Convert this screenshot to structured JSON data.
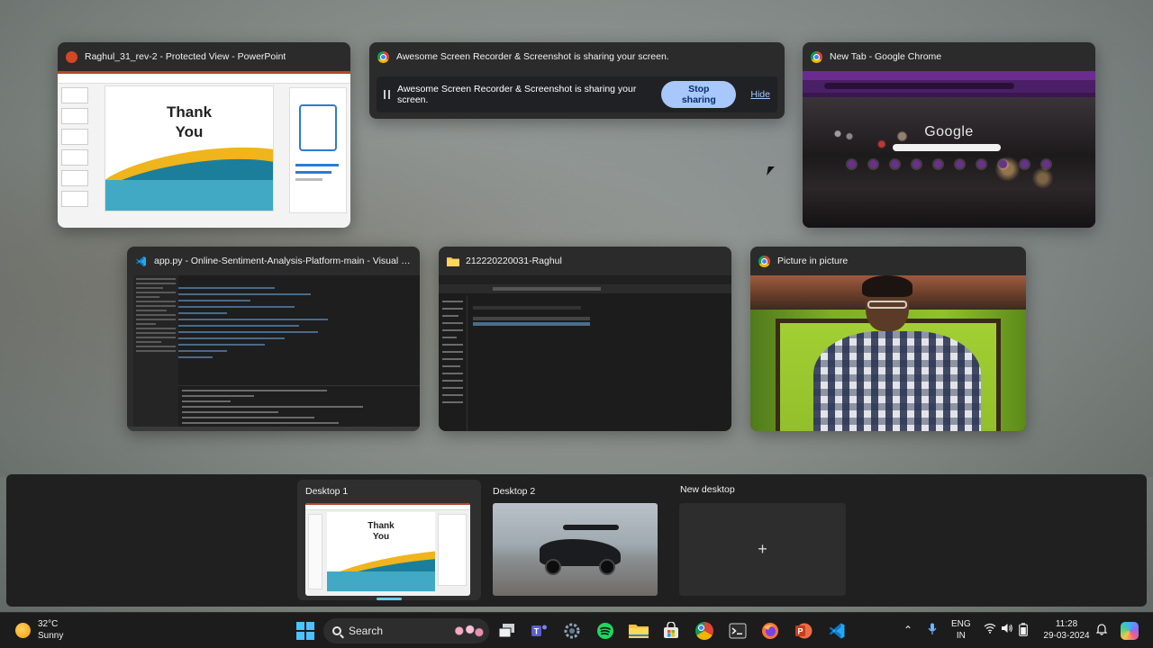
{
  "windows": [
    {
      "app": "powerpoint",
      "icon": "powerpoint-icon",
      "title": "Raghul_31_rev-2  -  Protected View - PowerPoint",
      "slide_text": "Thank You"
    },
    {
      "app": "chrome",
      "icon": "chrome-icon",
      "title": "New Tab - Google Chrome",
      "logo_text": "Google"
    },
    {
      "app": "vscode",
      "icon": "vscode-icon",
      "title": "app.py - Online-Sentiment-Analysis-Platform-main - Visual St..."
    },
    {
      "app": "explorer",
      "icon": "folder-icon",
      "title": "212220220031-Raghul"
    },
    {
      "app": "chrome",
      "icon": "chrome-icon",
      "title": "Picture in picture"
    }
  ],
  "share_bar": {
    "title": "Awesome Screen Recorder & Screenshot is sharing your screen.",
    "message": "Awesome Screen Recorder & Screenshot is sharing your screen.",
    "stop_label": "Stop sharing",
    "hide_label": "Hide"
  },
  "desktops": [
    {
      "label": "Desktop 1",
      "active": true,
      "slide_text": "Thank You"
    },
    {
      "label": "Desktop 2",
      "active": false
    },
    {
      "label": "New desktop",
      "plus": "+"
    }
  ],
  "taskbar": {
    "weather": {
      "temp": "32°C",
      "condition": "Sunny"
    },
    "search_label": "Search",
    "language": {
      "line1": "ENG",
      "line2": "IN"
    },
    "time": "11:28",
    "date": "29-03-2024",
    "apps": [
      "start-icon",
      "task-view-icon",
      "teams-icon",
      "settings-icon",
      "spotify-icon",
      "file-explorer-icon",
      "store-icon",
      "chrome-icon",
      "terminal-icon",
      "firefox-icon",
      "powerpoint-icon",
      "vscode-icon"
    ]
  },
  "colors": {
    "accent": "#60cdff",
    "stop_button": "#a8c7fa",
    "powerpoint": "#d24726",
    "vscode": "#23a9f2",
    "chrome_theme": "#6a2d8f"
  }
}
